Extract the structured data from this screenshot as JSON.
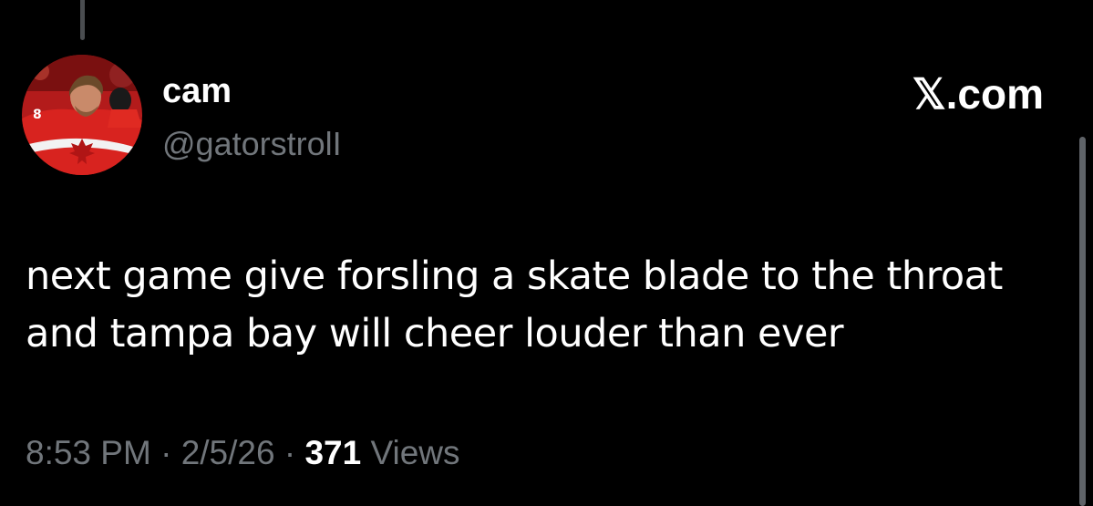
{
  "user": {
    "display_name": "cam",
    "handle": "@gatorstrolI"
  },
  "brand": {
    "label": "𝕏.com"
  },
  "tweet": {
    "line1": "next game give forsling a skate blade to the throat",
    "line2": "and tampa bay will cheer louder than ever"
  },
  "meta": {
    "time": "8:53 PM",
    "separator": "·",
    "date": "2/5/26",
    "views_count": "371",
    "views_label": "Views"
  },
  "colors": {
    "background": "#000000",
    "text_primary": "#ffffff",
    "text_secondary": "#71767b",
    "avatar_red": "#d8231f"
  }
}
